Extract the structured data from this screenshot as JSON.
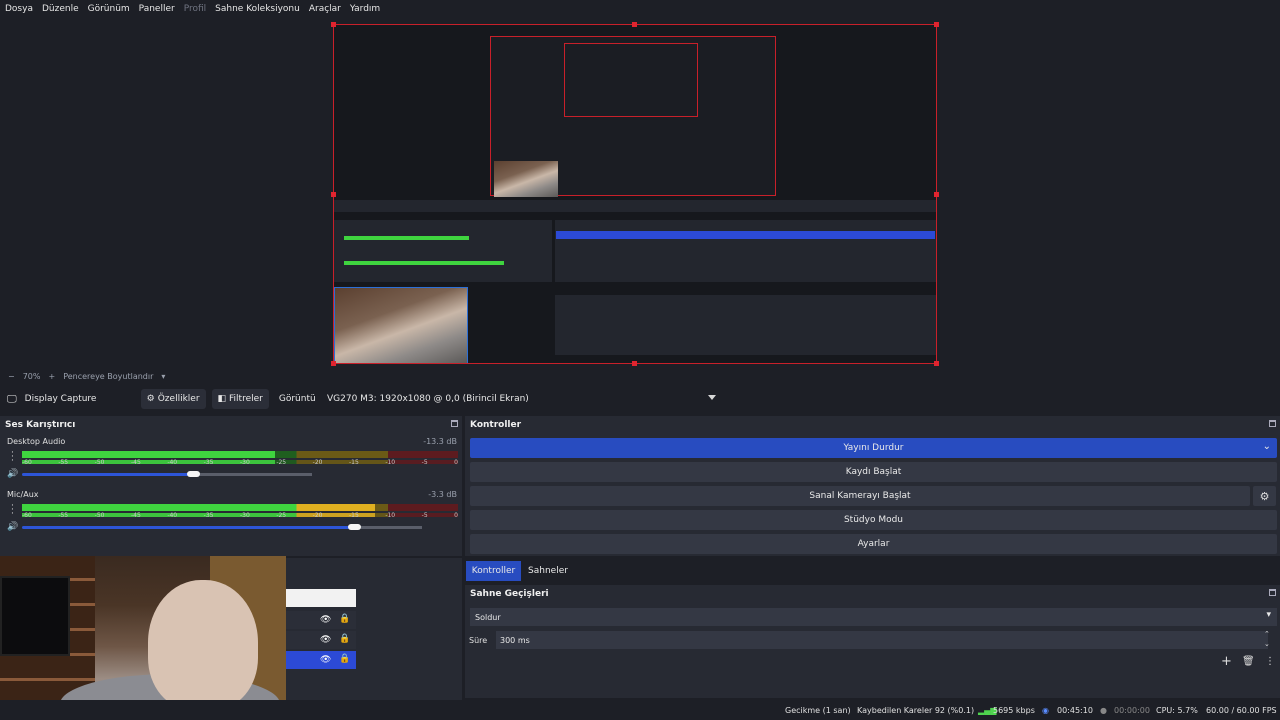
{
  "menu": {
    "items": [
      "Dosya",
      "Düzenle",
      "Görünüm",
      "Paneller",
      "Profil",
      "Sahne Koleksiyonu",
      "Araçlar",
      "Yardım"
    ],
    "disabled_index": 4
  },
  "preview": {
    "zoom": "70%",
    "scale_mode": "Pencereye Boyutlandır"
  },
  "source_toolbar": {
    "source_name": "Display Capture",
    "properties_label": "Özellikler",
    "filters_label": "Filtreler",
    "display_label": "Görüntü",
    "display_value": "VG270 M3: 1920x1080 @ 0,0 (Birincil Ekran)"
  },
  "mixer": {
    "title": "Ses Karıştırıcı",
    "tracks": [
      {
        "name": "Desktop Audio",
        "db": "-13.3 dB",
        "level_fraction": 0.58,
        "volume_fraction": 0.59
      },
      {
        "name": "Mic/Aux",
        "db": "-3.3 dB",
        "level_fraction": 0.81,
        "volume_fraction": 0.83
      }
    ],
    "scale": [
      "-60",
      "-55",
      "-50",
      "-45",
      "-40",
      "-35",
      "-30",
      "-25",
      "-20",
      "-15",
      "-10",
      "-5",
      "0"
    ]
  },
  "controls": {
    "title": "Kontroller",
    "stop_stream": "Yayını Durdur",
    "start_recording": "Kaydı Başlat",
    "start_virtual_camera": "Sanal Kamerayı Başlat",
    "studio_mode": "Stüdyo Modu",
    "settings": "Ayarlar"
  },
  "tabs": {
    "controls": "Kontroller",
    "scenes": "Sahneler"
  },
  "transitions": {
    "title": "Sahne Geçişleri",
    "selected": "Soldur",
    "duration_label": "Süre",
    "duration_value": "300 ms"
  },
  "status": {
    "delay": "Gecikme (1 san)",
    "dropped_frames": "Kaybedilen Kareler 92 (%0.1)",
    "bitrate": "5695 kbps",
    "stream_time": "00:45:10",
    "record_time": "00:00:00",
    "cpu": "CPU: 5.7%",
    "fps": "60.00 / 60.00 FPS"
  },
  "colors": {
    "accent": "#284cc0",
    "selection_red": "#c8202a",
    "meter_green": "#3fd43f",
    "meter_yellow": "#e0b020",
    "meter_red": "#a01f28"
  }
}
